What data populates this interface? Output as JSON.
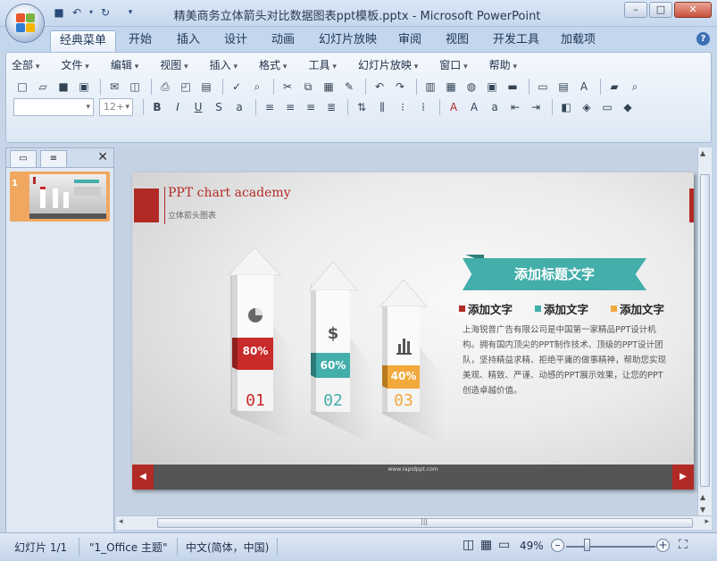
{
  "window": {
    "title": "精美商务立体箭头对比数据图表ppt模板.pptx - Microsoft PowerPoint",
    "min_icon": "minimize-icon",
    "max_icon": "maximize-icon",
    "close_icon": "close-icon"
  },
  "quick_access": {
    "save_icon": "save-icon",
    "undo_icon": "undo-icon",
    "redo_icon": "redo-icon",
    "customize_icon": "customize-icon"
  },
  "tabs": [
    "经典菜单",
    "开始",
    "插入",
    "设计",
    "动画",
    "幻灯片放映",
    "审阅",
    "视图",
    "开发工具",
    "加载项"
  ],
  "active_tab": "经典菜单",
  "classic_menu": [
    "全部",
    "文件",
    "编辑",
    "视图",
    "插入",
    "格式",
    "工具",
    "幻灯片放映",
    "窗口",
    "帮助"
  ],
  "font_size_placeholder": "12+",
  "left_pane": {
    "slide_number": "1"
  },
  "slide": {
    "title": "PPT chart academy",
    "subtitle": "立体箭头图表",
    "banner": "添加标题文字",
    "legend": [
      {
        "label": "添加文字",
        "color": "#b22a26"
      },
      {
        "label": "添加文字",
        "color": "#43aeaa"
      },
      {
        "label": "添加文字",
        "color": "#f2a93b"
      }
    ],
    "description": "上海锐普广告有限公司是中国第一家精品PPT设计机构。拥有国内顶尖的PPT制作技术、顶级的PPT设计团队，坚持精益求精、拒绝平庸的做事精神，帮助您实现美观、精致、严谨、动感的PPT展示效果，让您的PPT创造卓越价值。",
    "arrows": [
      {
        "number": "01",
        "percent": "80%",
        "color": "#c92a2a",
        "icon": "pie-chart-icon"
      },
      {
        "number": "02",
        "percent": "60%",
        "color": "#43aeaa",
        "icon": "dollar-icon"
      },
      {
        "number": "03",
        "percent": "40%",
        "color": "#f2a93b",
        "icon": "bar-chart-icon"
      }
    ],
    "footer_url": "www.rapidppt.com"
  },
  "status": {
    "slide_count": "幻灯片 1/1",
    "theme": "\"1_Office 主题\"",
    "language": "中文(简体，中国)",
    "zoom": "49%"
  }
}
